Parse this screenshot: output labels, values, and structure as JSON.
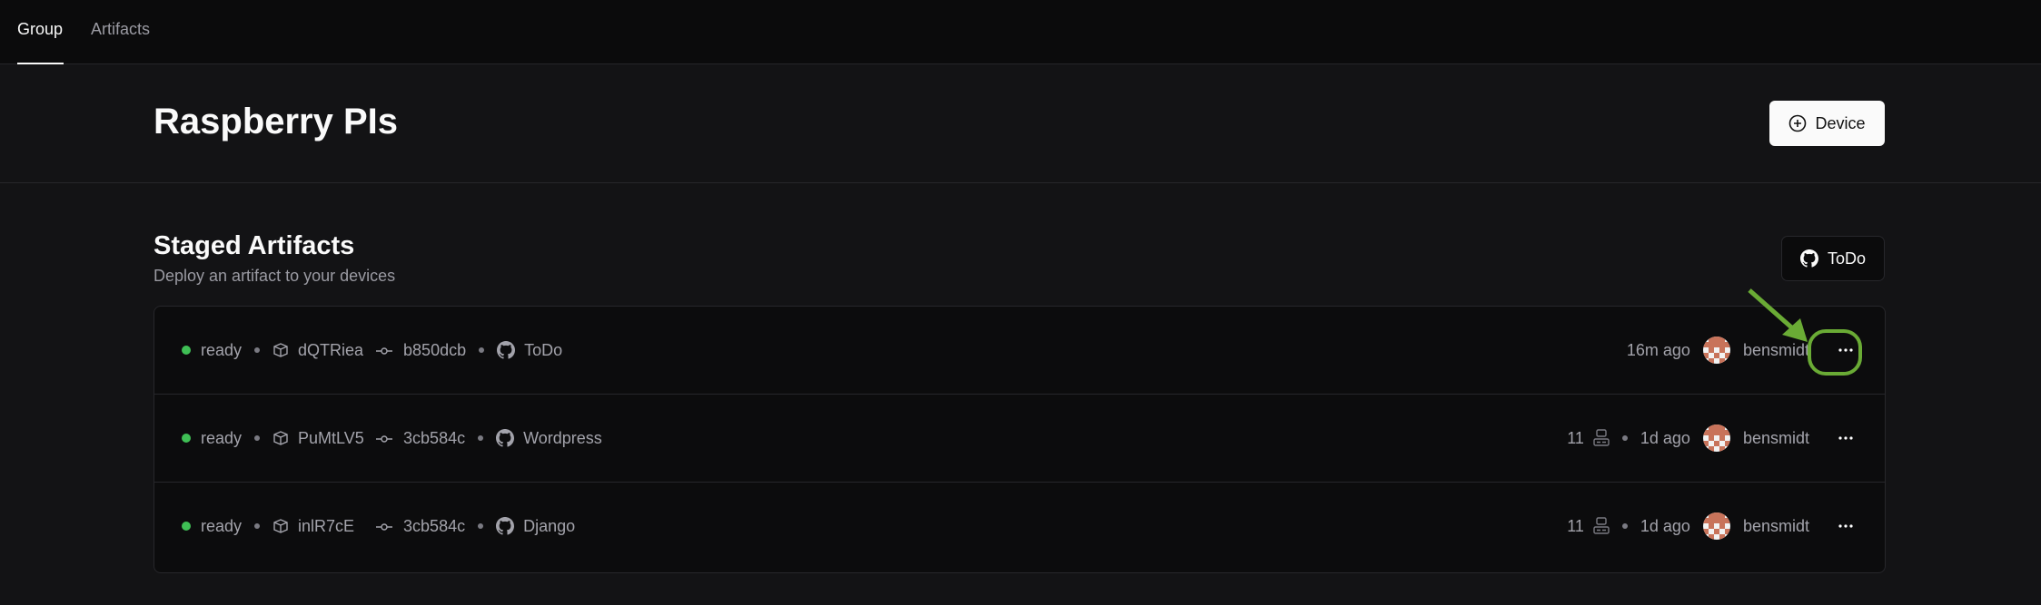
{
  "tabs": [
    {
      "label": "Group",
      "active": true
    },
    {
      "label": "Artifacts",
      "active": false
    }
  ],
  "page_title": "Raspberry PIs",
  "device_button": {
    "label": "Device",
    "icon": "plus-circle-icon"
  },
  "section": {
    "title": "Staged Artifacts",
    "subtitle": "Deploy an artifact to your devices",
    "repo_button": {
      "label": "ToDo",
      "icon": "github-icon"
    }
  },
  "rows": [
    {
      "status": "ready",
      "artifact": "dQTRiea",
      "commit": "b850dcb",
      "repo": "ToDo",
      "devices": "",
      "time": "16m ago",
      "user": "bensmidt",
      "highlighted": true
    },
    {
      "status": "ready",
      "artifact": "PuMtLV5",
      "commit": "3cb584c",
      "repo": "Wordpress",
      "devices": "11",
      "time": "1d ago",
      "user": "bensmidt",
      "highlighted": false
    },
    {
      "status": "ready",
      "artifact": "inlR7cE",
      "commit": "3cb584c",
      "repo": "Django",
      "devices": "11",
      "time": "1d ago",
      "user": "bensmidt",
      "highlighted": false
    }
  ],
  "colors": {
    "status_ready": "#3fbf55",
    "annotation": "#6aab35",
    "avatar": "#c8735a"
  }
}
